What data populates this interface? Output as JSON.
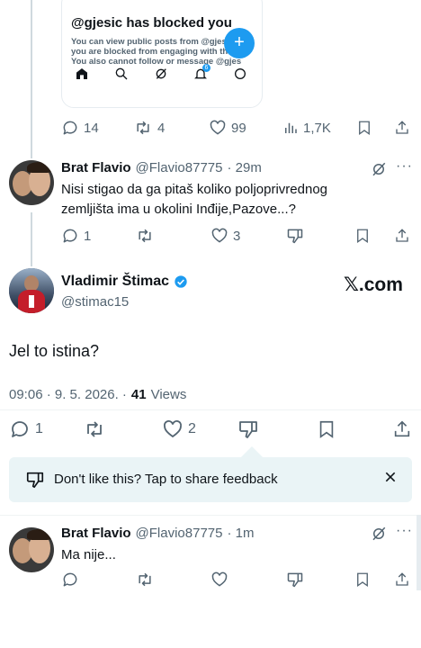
{
  "blocked_card": {
    "title": "@gjesic has blocked you",
    "line1": "You can view public posts from @gjesic,",
    "line2": "you are blocked from engaging with the",
    "line3": "You also cannot follow or message @gjes",
    "notification_count": "6"
  },
  "tweet1_actions": {
    "replies": "14",
    "reposts": "4",
    "likes": "99",
    "views": "1,7K"
  },
  "reply1": {
    "name": "Brat Flavio",
    "handle": "@Flavio87775",
    "time": "· 29m",
    "text_line1": "Nisi stigao da ga pitaš koliko poljoprivrednog",
    "text_line2": "zemljišta ima u okolini Inđije,Pazove...?",
    "replies": "1",
    "likes": "3"
  },
  "main_tweet": {
    "name": "Vladimir Štimac",
    "handle": "@stimac15",
    "watermark": "𝕏.com",
    "text": "Jel to istina?",
    "timestamp": "09:06 · 9. 5. 2026. ·",
    "views_count": "41",
    "views_label": "Views",
    "replies": "1",
    "likes": "2"
  },
  "feedback_banner": {
    "text": "Don't like this? Tap to share feedback"
  },
  "reply2": {
    "name": "Brat Flavio",
    "handle": "@Flavio87775",
    "time": "· 1m",
    "text": "Ma nije..."
  }
}
